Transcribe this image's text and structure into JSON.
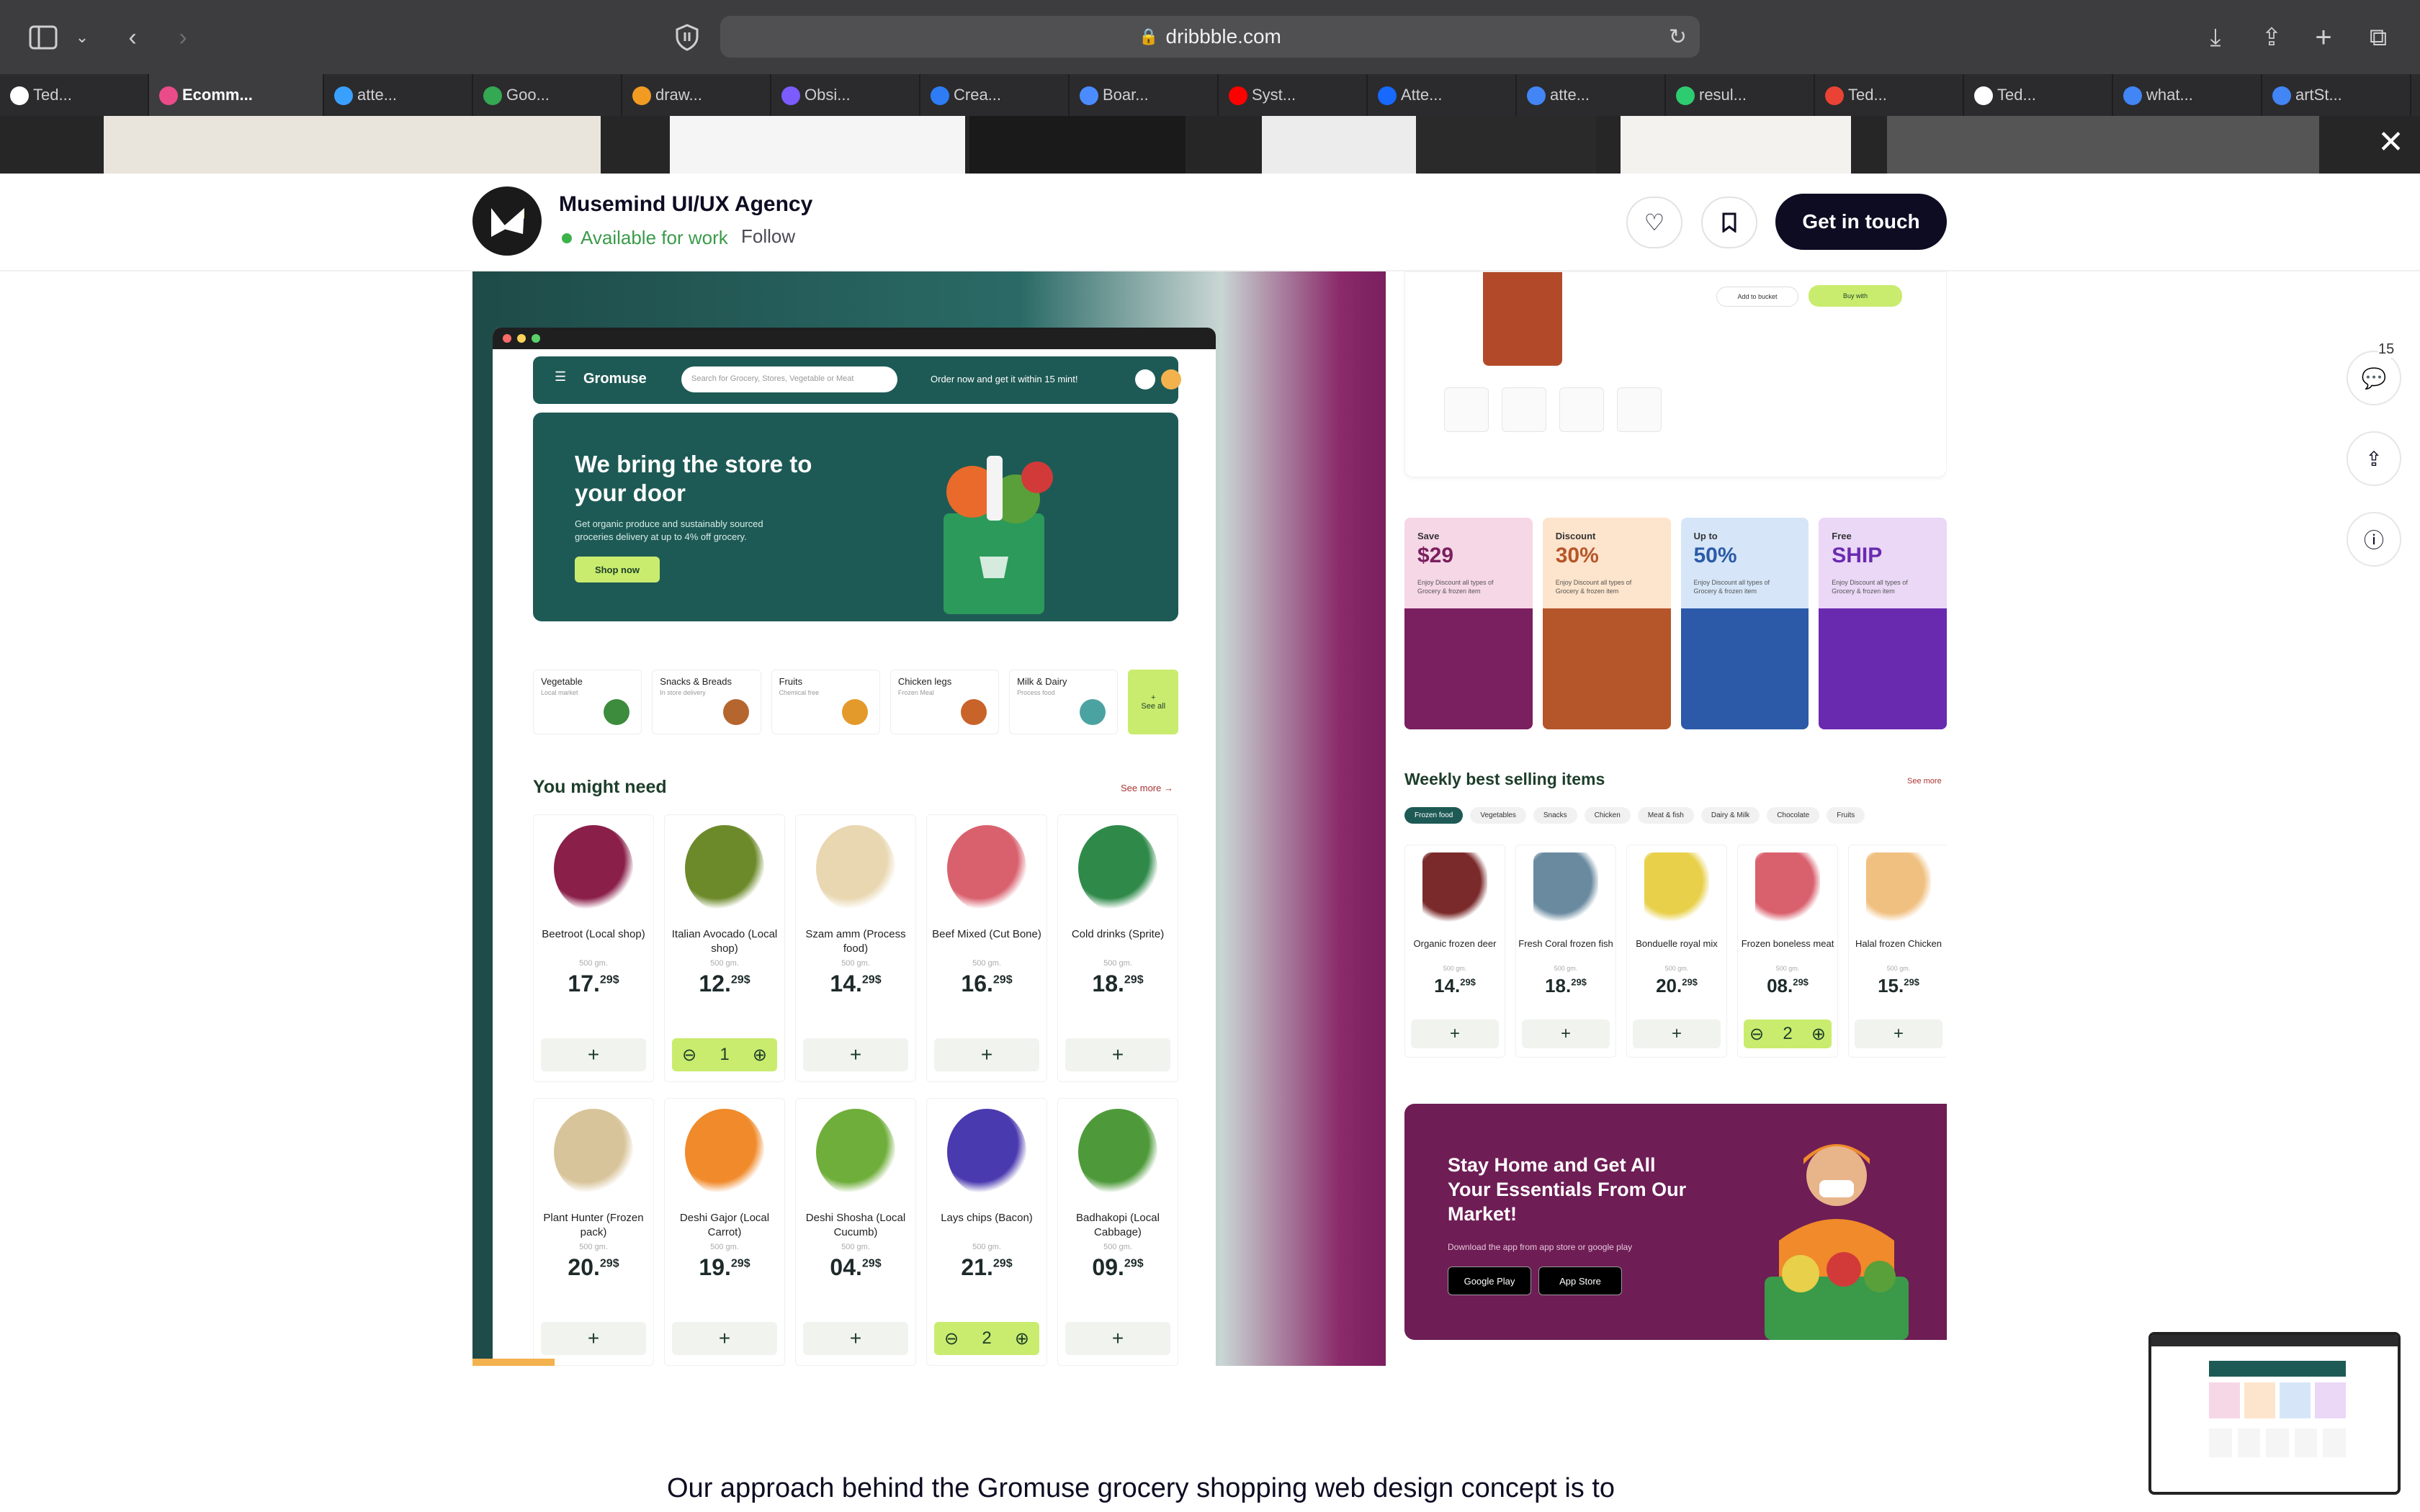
{
  "browser": {
    "url": "dribbble.com",
    "tabs": [
      {
        "label": "Ted...",
        "color": "#ffffff"
      },
      {
        "label": "Ecomm...",
        "color": "#ea4c89",
        "active": true
      },
      {
        "label": "atte...",
        "color": "#3aa0ff"
      },
      {
        "label": "Goo...",
        "color": "#34a853"
      },
      {
        "label": "draw...",
        "color": "#f29b22"
      },
      {
        "label": "Obsi...",
        "color": "#7c5cff"
      },
      {
        "label": "Crea...",
        "color": "#2d7cf6"
      },
      {
        "label": "Boar...",
        "color": "#4a8cff"
      },
      {
        "label": "Syst...",
        "color": "#ff0000"
      },
      {
        "label": "Atte...",
        "color": "#1769ff"
      },
      {
        "label": "atte...",
        "color": "#4285f4"
      },
      {
        "label": "resul...",
        "color": "#2ecc71"
      },
      {
        "label": "Ted...",
        "color": "#ea4335"
      },
      {
        "label": "Ted...",
        "color": "#ffffff"
      },
      {
        "label": "what...",
        "color": "#4285f4"
      },
      {
        "label": "artSt...",
        "color": "#4285f4"
      }
    ]
  },
  "shot_header": {
    "studio_name": "Musemind UI/UX Agency",
    "availability": "Available for work",
    "follow_label": "Follow",
    "cta_label": "Get in touch"
  },
  "mockup": {
    "brand": "Gromuse",
    "search_placeholder": "Search for Grocery, Stores, Vegetable or Meat",
    "promo_text": "Order now and get it within 15 mint!",
    "hero_title": "We bring the store to your door",
    "hero_text": "Get organic produce and sustainably sourced groceries delivery at up to 4% off grocery.",
    "hero_button": "Shop now",
    "categories": [
      {
        "name": "Vegetable",
        "sub": "Local market",
        "color": "#3d8b3d"
      },
      {
        "name": "Snacks & Breads",
        "sub": "In store delivery",
        "color": "#b5652e"
      },
      {
        "name": "Fruits",
        "sub": "Chemical free",
        "color": "#e39a2a"
      },
      {
        "name": "Chicken legs",
        "sub": "Frozen Meal",
        "color": "#c8632a"
      },
      {
        "name": "Milk & Dairy",
        "sub": "Process food",
        "color": "#4aa3a0"
      }
    ],
    "see_all": "See all",
    "section_title": "You might need",
    "see_more": "See more →",
    "products": [
      {
        "name": "Beetroot (Local shop)",
        "weight": "500 gm.",
        "price": "17.",
        "cents": "29$",
        "color": "#8a1f4a"
      },
      {
        "name": "Italian Avocado (Local shop)",
        "weight": "500 gm.",
        "price": "12.",
        "cents": "29$",
        "color": "#6c8a2a",
        "qty": "1"
      },
      {
        "name": "Szam amm (Process food)",
        "weight": "500 gm.",
        "price": "14.",
        "cents": "29$",
        "color": "#e8d7b0"
      },
      {
        "name": "Beef Mixed (Cut Bone)",
        "weight": "500 gm.",
        "price": "16.",
        "cents": "29$",
        "color": "#d9616e"
      },
      {
        "name": "Cold drinks (Sprite)",
        "weight": "500 gm.",
        "price": "18.",
        "cents": "29$",
        "color": "#2f8a4a"
      },
      {
        "name": "Plant Hunter (Frozen pack)",
        "weight": "500 gm.",
        "price": "20.",
        "cents": "29$",
        "color": "#d8c49a"
      },
      {
        "name": "Deshi Gajor (Local Carrot)",
        "weight": "500 gm.",
        "price": "19.",
        "cents": "29$",
        "color": "#f08a2a"
      },
      {
        "name": "Deshi Shosha (Local Cucumb)",
        "weight": "500 gm.",
        "price": "04.",
        "cents": "29$",
        "color": "#6fae3a"
      },
      {
        "name": "Lays chips (Bacon)",
        "weight": "500 gm.",
        "price": "21.",
        "cents": "29$",
        "color": "#4a3ab0",
        "qty": "2"
      },
      {
        "name": "Badhakopi (Local Cabbage)",
        "weight": "500 gm.",
        "price": "09.",
        "cents": "29$",
        "color": "#4e9a3a"
      }
    ]
  },
  "right_panel": {
    "add_to_bucket": "Add to bucket",
    "buy_with": "Buy with",
    "promos": [
      {
        "top": "Save",
        "value": "$29",
        "desc": "Enjoy Discount all types of Grocery & frozen item",
        "bg": "#f6d7e6",
        "bottom": "#7a1f5f",
        "vcolor": "#7a1f5f"
      },
      {
        "top": "Discount",
        "value": "30%",
        "desc": "Enjoy Discount all types of Grocery & frozen item",
        "bg": "#fde4cc",
        "bottom": "#b5562a",
        "vcolor": "#b5562a"
      },
      {
        "top": "Up to",
        "value": "50%",
        "desc": "Enjoy Discount all types of Grocery & frozen item",
        "bg": "#d6e6f8",
        "bottom": "#2c5aa8",
        "vcolor": "#2c5aa8"
      },
      {
        "top": "Free",
        "value": "SHIP",
        "desc": "Enjoy Discount all types of Grocery & frozen item",
        "bg": "#ead8f6",
        "bottom": "#6a2ab0",
        "vcolor": "#6a2ab0"
      }
    ],
    "weekly_title": "Weekly best selling items",
    "weekly_more": "See more",
    "filters": [
      "Frozen food",
      "Vegetables",
      "Snacks",
      "Chicken",
      "Meat & fish",
      "Dairy & Milk",
      "Chocolate",
      "Fruits"
    ],
    "weekly": [
      {
        "name": "Organic frozen deer",
        "weight": "500 gm.",
        "price": "14.",
        "cents": "29$",
        "color": "#7a2a2a"
      },
      {
        "name": "Fresh Coral frozen fish",
        "weight": "500 gm.",
        "price": "18.",
        "cents": "29$",
        "color": "#6a8aa0"
      },
      {
        "name": "Bonduelle royal mix",
        "weight": "500 gm.",
        "price": "20.",
        "cents": "29$",
        "color": "#e8d04a"
      },
      {
        "name": "Frozen boneless meat",
        "weight": "500 gm.",
        "price": "08.",
        "cents": "29$",
        "color": "#d9616e",
        "qty": "2"
      },
      {
        "name": "Halal frozen Chicken",
        "weight": "500 gm.",
        "price": "15.",
        "cents": "29$",
        "color": "#f0c080"
      }
    ],
    "banner_title": "Stay Home and Get All Your Essentials From Our Market!",
    "banner_text": "Download the app from app store or google play",
    "google_play": "Google Play",
    "app_store": "App Store"
  },
  "side": {
    "comment_count": "15"
  },
  "description": "Our approach behind the Gromuse grocery shopping web design concept is to"
}
